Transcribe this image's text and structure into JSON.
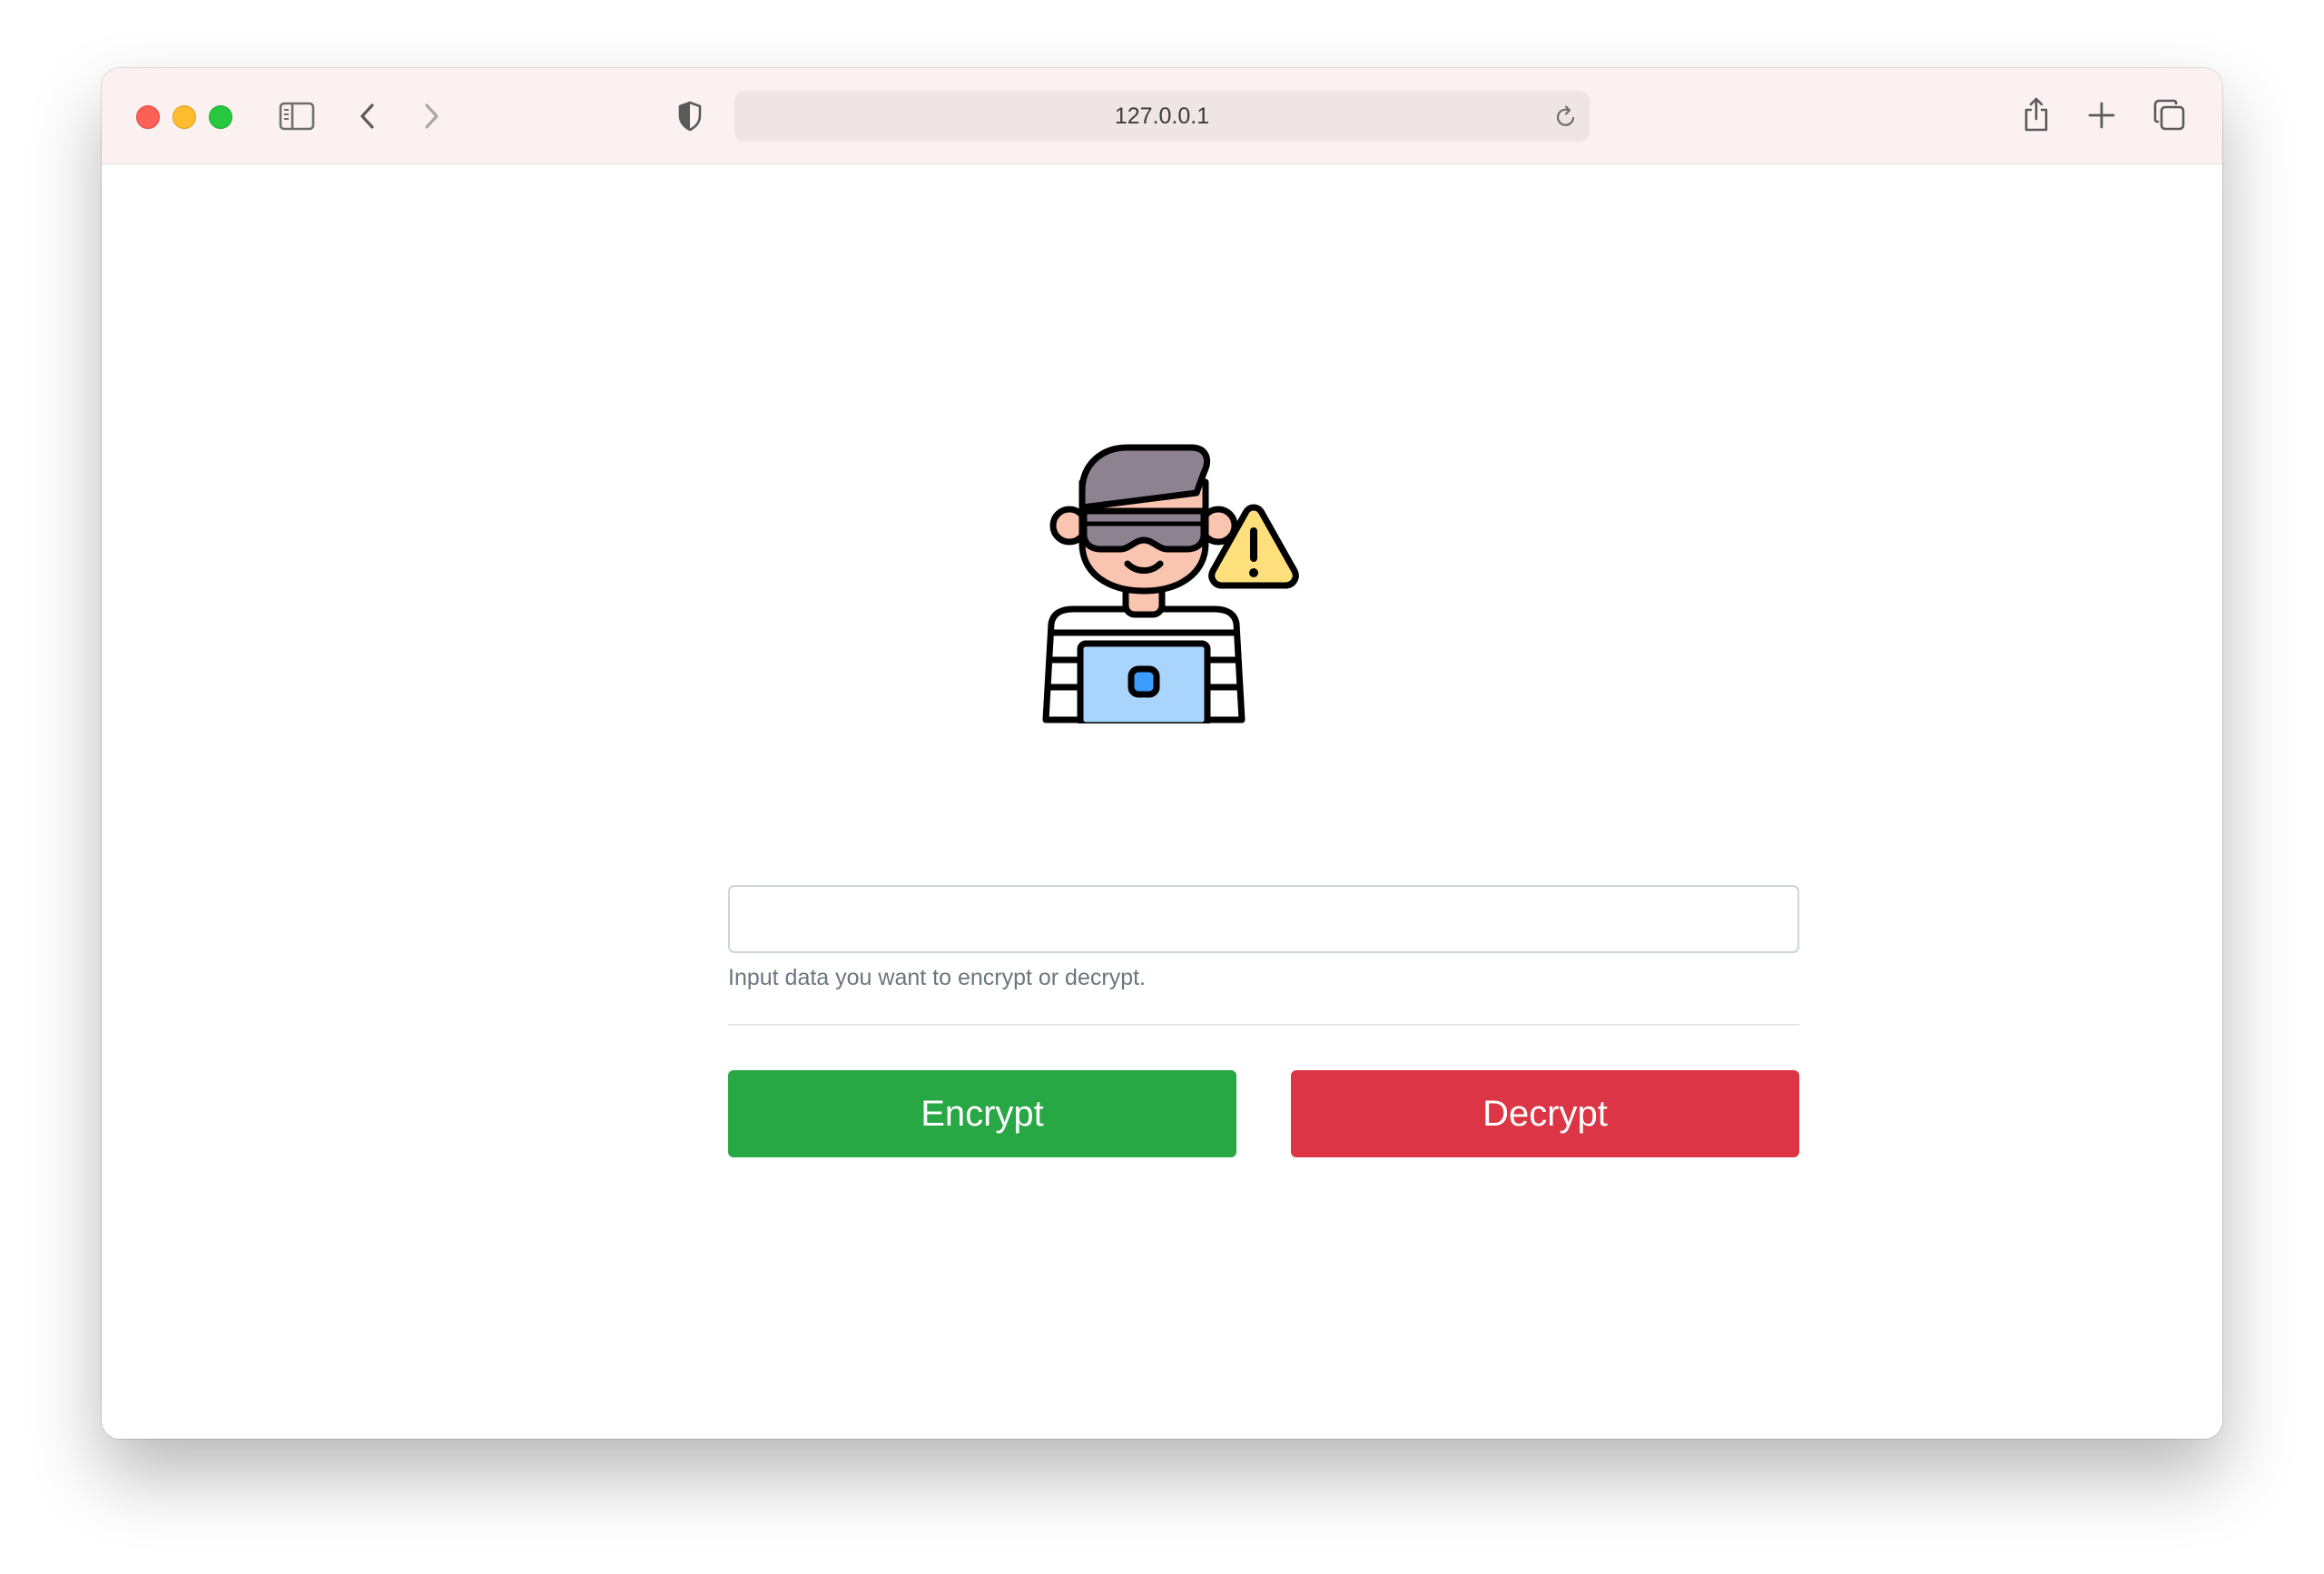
{
  "browser": {
    "url": "127.0.0.1",
    "icons": {
      "close": "close-light",
      "minimize": "minimize-light",
      "zoom": "zoom-light",
      "sidebar": "sidebar-icon",
      "back": "chevron-left-icon",
      "forward": "chevron-right-icon",
      "privacy": "shield-icon",
      "reload": "reload-icon",
      "share": "share-icon",
      "new_tab": "plus-icon",
      "tabs": "tab-overview-icon"
    },
    "colors": {
      "close": "#fe5f57",
      "minimize": "#febc2e",
      "zoom": "#28c840"
    }
  },
  "page": {
    "illustration": "hacker-with-warning-illustration",
    "input": {
      "value": "",
      "placeholder": ""
    },
    "helper_text": "Input data you want to encrypt or decrypt.",
    "buttons": {
      "encrypt": "Encrypt",
      "decrypt": "Decrypt"
    },
    "colors": {
      "encrypt": "#28a745",
      "decrypt": "#dc3545"
    }
  }
}
